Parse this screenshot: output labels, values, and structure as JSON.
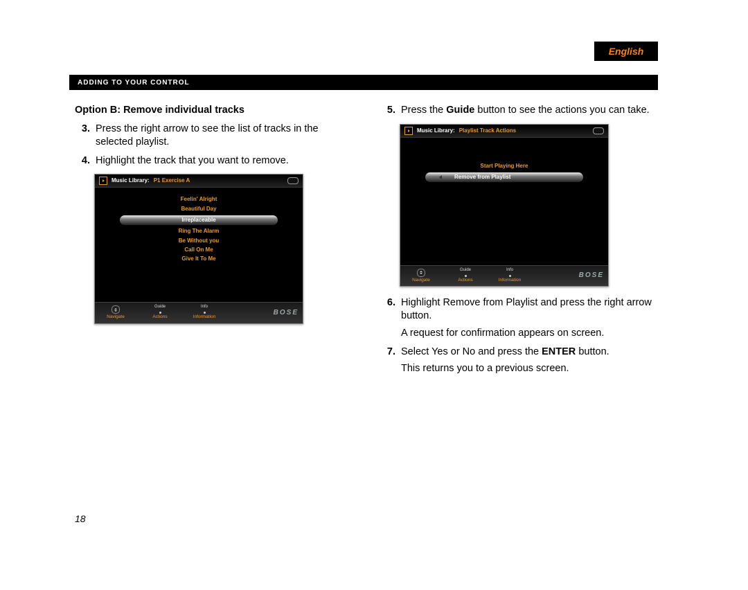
{
  "lang_tab": "English",
  "header_bar": "ADDING TO YOUR CONTROL",
  "page_number": "18",
  "col_left": {
    "option_title": "Option B: Remove individual tracks",
    "steps": [
      {
        "num": "3.",
        "text": "Press the right arrow to see the list of tracks in the selected playlist."
      },
      {
        "num": "4.",
        "text": "Highlight the track that you want to remove."
      }
    ]
  },
  "col_right": {
    "steps_a": [
      {
        "num": "5.",
        "html": "Press the <b>Guide</b> button to see the actions you can take."
      }
    ],
    "steps_b": [
      {
        "num": "6.",
        "html": "Highlight Remove from Playlist and press the right arrow button.",
        "sub": "A request for confirmation appears on screen."
      },
      {
        "num": "7.",
        "html": "Select Yes or No and press the <b>ENTER</b> button.",
        "sub": "This returns you to a previous screen."
      }
    ]
  },
  "device1": {
    "title_main": "Music Library:",
    "title_sub": "P1 Exercise A",
    "tracks": [
      "Feelin' Alright",
      "Beautiful Day",
      "Irreplaceable",
      "Ring The Alarm",
      "Be Without you",
      "Call On Me",
      "Give It To Me"
    ],
    "selected_index": 2,
    "footer": {
      "navigate": "Navigate",
      "guide_top": "Guide",
      "guide_bot": "Actions",
      "info_top": "Info",
      "info_bot": "Information",
      "logo": "BOSE"
    }
  },
  "device2": {
    "title_main": "Music Library:",
    "title_sub": "Playlist Track Actions",
    "items": [
      "Start Playing Here",
      "Remove from Playlist"
    ],
    "selected_index": 1,
    "footer": {
      "navigate": "Navigate",
      "guide_top": "Guide",
      "guide_bot": "Actions",
      "info_top": "Info",
      "info_bot": "Information",
      "logo": "BOSE"
    }
  }
}
